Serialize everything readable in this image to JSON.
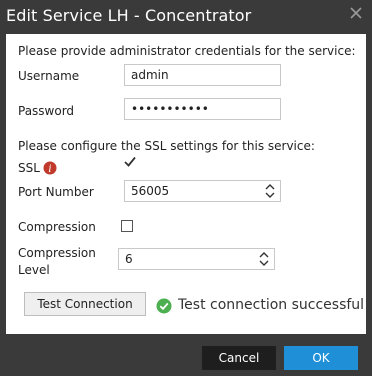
{
  "window": {
    "title": "Edit Service LH - Concentrator"
  },
  "form": {
    "credentials_prompt": "Please provide administrator credentials for the service:",
    "username": {
      "label": "Username",
      "value": "admin"
    },
    "password": {
      "label": "Password",
      "value": "•••••••••••"
    },
    "ssl_prompt": "Please configure the SSL settings for this service:",
    "ssl": {
      "label": "SSL",
      "checked": true,
      "info_icon": "info-icon"
    },
    "port": {
      "label": "Port Number",
      "value": "56005"
    },
    "compression": {
      "label": "Compression",
      "checked": false
    },
    "compression_level": {
      "label_line1": "Compression",
      "label_line2": "Level",
      "value": "6"
    }
  },
  "test": {
    "button_label": "Test Connection",
    "status_text": "Test connection successful",
    "status_icon": "success-check-icon",
    "status_color": "#4caf50"
  },
  "footer": {
    "cancel_label": "Cancel",
    "ok_label": "OK",
    "ok_color": "#1f8fd8"
  }
}
